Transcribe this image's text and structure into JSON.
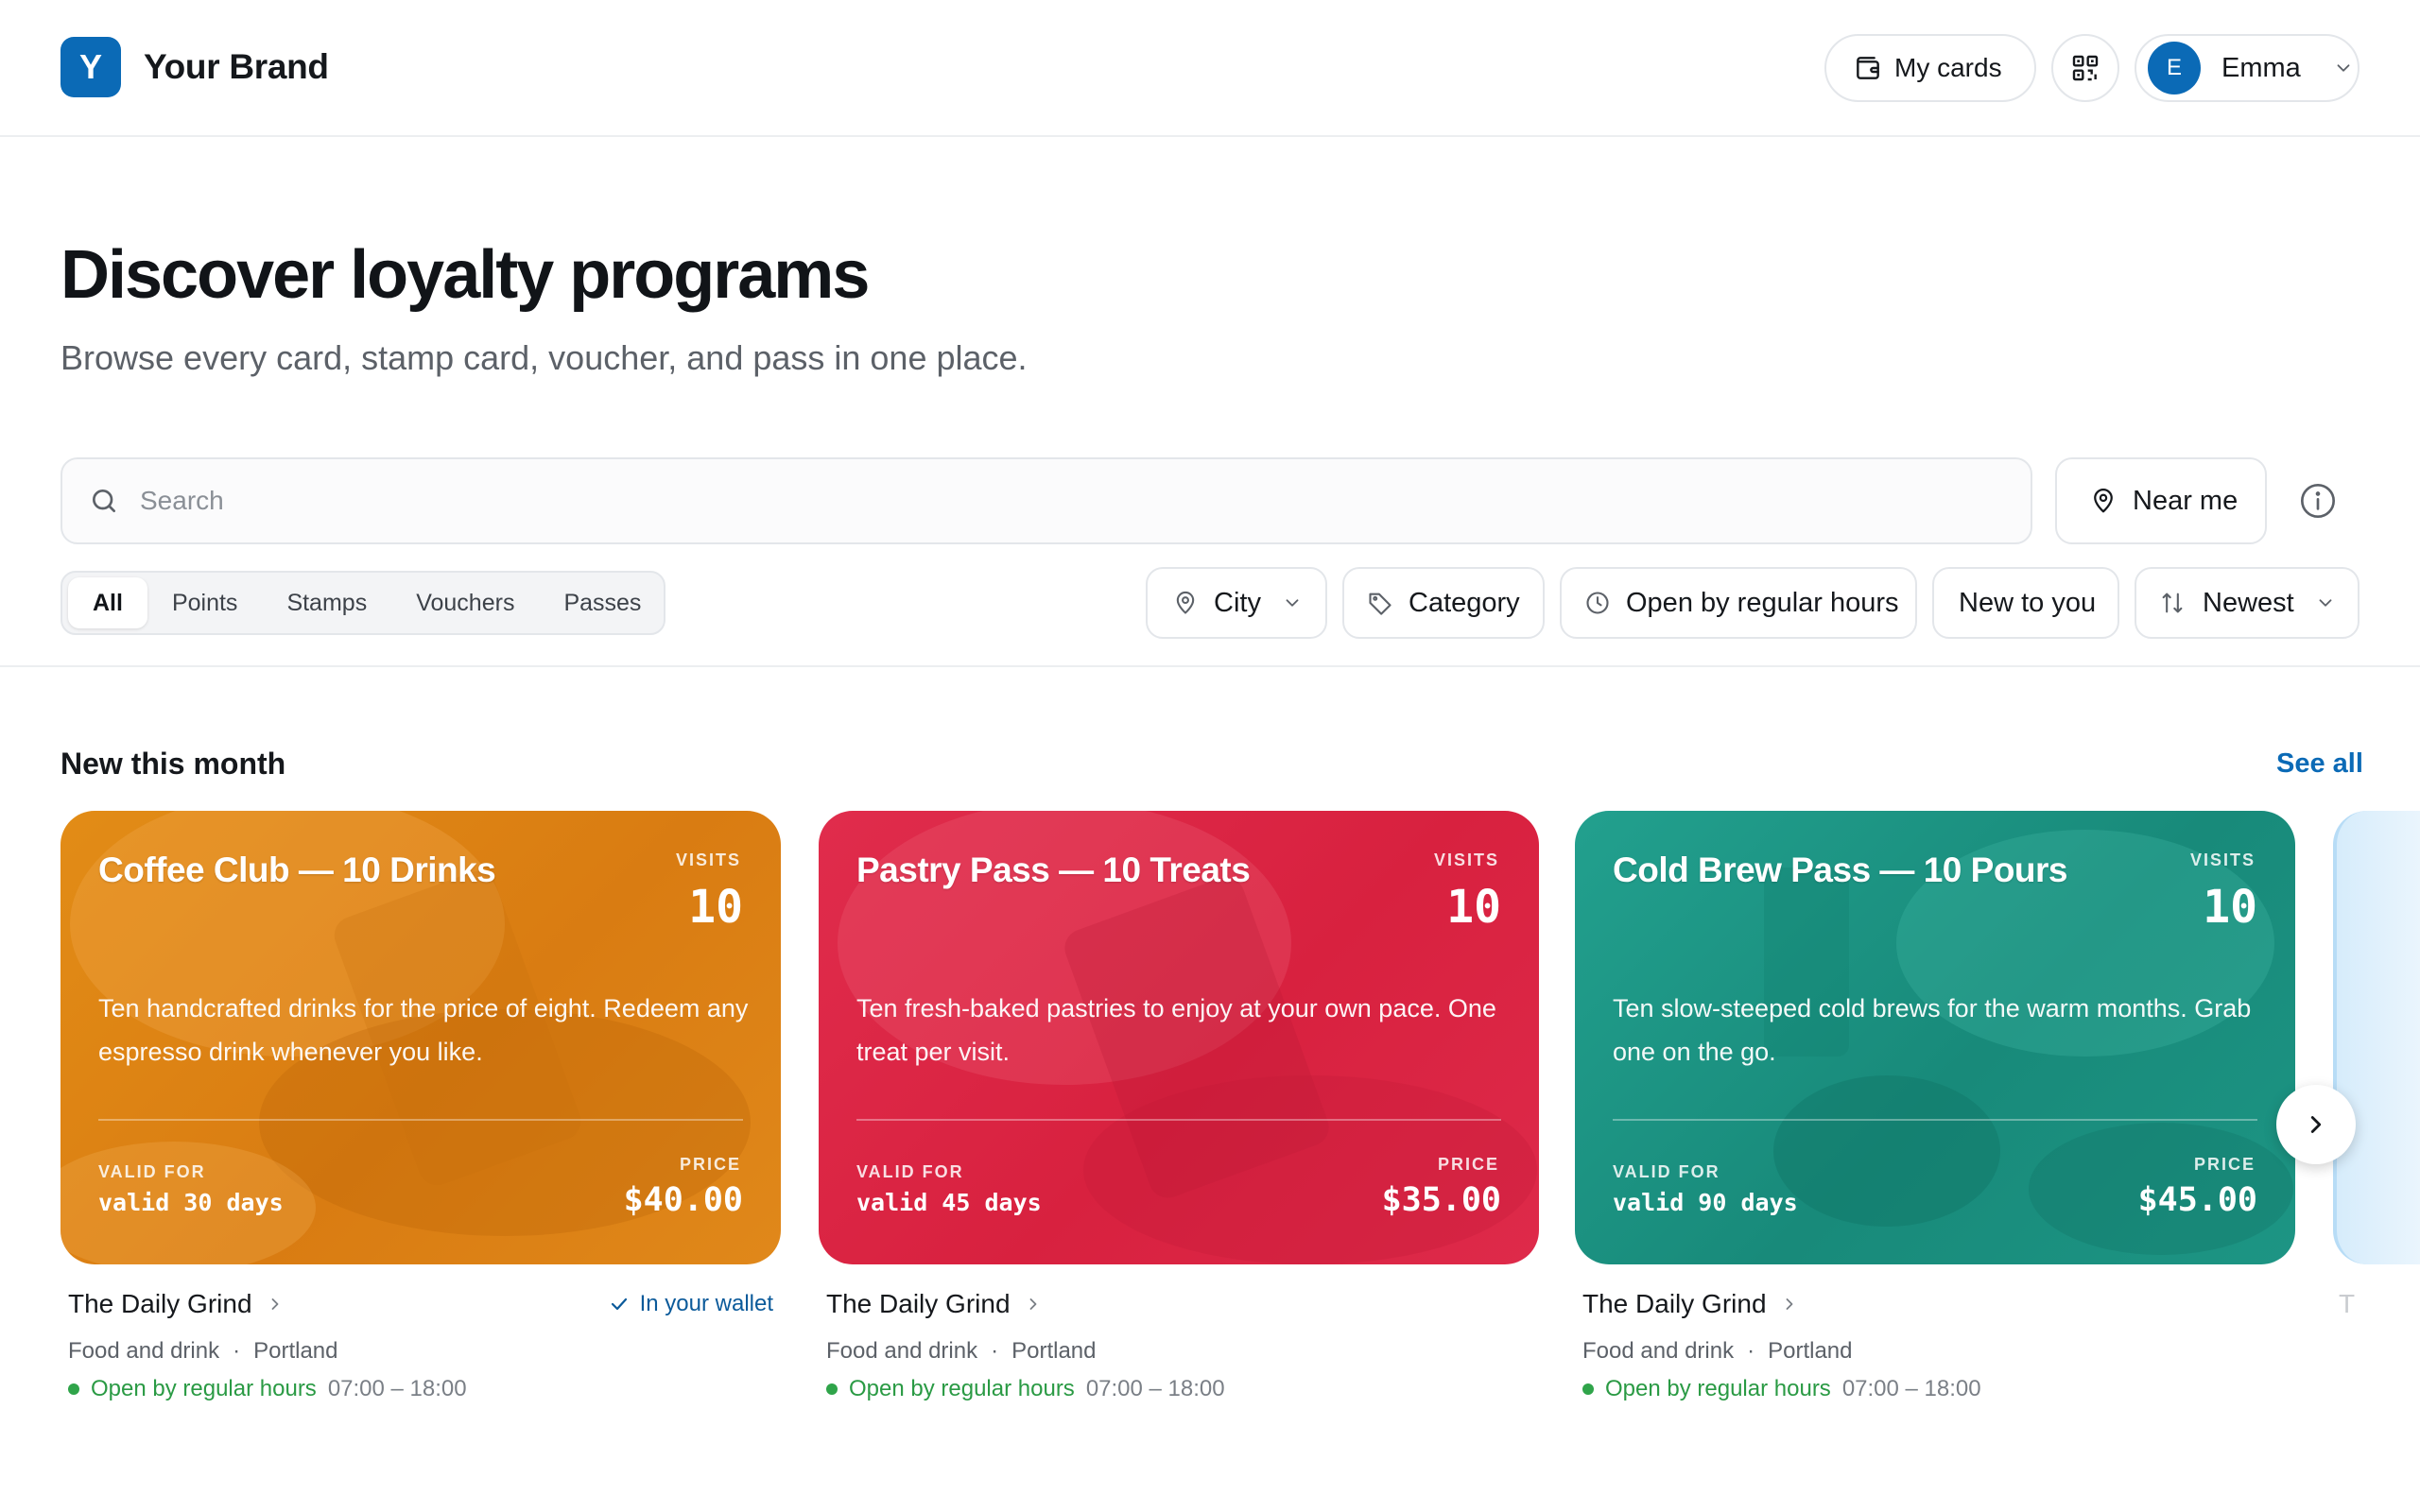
{
  "brand": {
    "logo_letter": "Y",
    "name": "Your Brand",
    "color": "#0b6ab6"
  },
  "header": {
    "my_cards": "My cards",
    "user": {
      "initial": "E",
      "name": "Emma"
    }
  },
  "hero": {
    "title": "Discover loyalty programs",
    "subtitle": "Browse every card, stamp card, voucher, and pass in one place."
  },
  "search": {
    "placeholder": "Search",
    "value": ""
  },
  "near_me": "Near me",
  "tabs": [
    {
      "label": "All",
      "active": true
    },
    {
      "label": "Points",
      "active": false
    },
    {
      "label": "Stamps",
      "active": false
    },
    {
      "label": "Vouchers",
      "active": false
    },
    {
      "label": "Passes",
      "active": false
    }
  ],
  "filters": {
    "city": "City",
    "category": "Category",
    "open": "Open by regular hours",
    "new_to_you": "New to you",
    "sort": "Newest"
  },
  "section": {
    "title": "New this month",
    "see_all": "See all"
  },
  "cards": [
    {
      "title": "Coffee Club — 10 Drinks",
      "kind_label": "VISITS",
      "count": "10",
      "description": "Ten handcrafted drinks for the price of eight. Redeem any espresso drink whenever you like.",
      "valid_label": "VALID FOR",
      "valid": "valid 30 days",
      "price_label": "PRICE",
      "price": "$40.00",
      "color": "#e08a1a",
      "business": "The Daily Grind",
      "in_wallet": "In your wallet",
      "category": "Food and drink",
      "city": "Portland",
      "open_status": "Open by regular hours",
      "hours": "07:00 – 18:00"
    },
    {
      "title": "Pastry Pass — 10 Treats",
      "kind_label": "VISITS",
      "count": "10",
      "description": "Ten fresh-baked pastries to enjoy at your own pace. One treat per visit.",
      "valid_label": "VALID FOR",
      "valid": "valid 45 days",
      "price_label": "PRICE",
      "price": "$35.00",
      "color": "#df2a4a",
      "business": "The Daily Grind",
      "category": "Food and drink",
      "city": "Portland",
      "open_status": "Open by regular hours",
      "hours": "07:00 – 18:00"
    },
    {
      "title": "Cold Brew Pass — 10 Pours",
      "kind_label": "VISITS",
      "count": "10",
      "description": "Ten slow-steeped cold brews for the warm months. Grab one on the go.",
      "valid_label": "VALID FOR",
      "valid": "valid 90 days",
      "price_label": "PRICE",
      "price": "$45.00",
      "color": "#1f9b8a",
      "business": "The Daily Grind",
      "category": "Food and drink",
      "city": "Portland",
      "open_status": "Open by regular hours",
      "hours": "07:00 – 18:00"
    }
  ],
  "peek": {
    "letter": "T"
  },
  "icons": {
    "wallet": "wallet-icon",
    "qr": "qr-code-icon",
    "search": "search-icon",
    "pin": "map-pin-icon",
    "info": "info-icon",
    "tag": "tag-icon",
    "clock": "clock-icon",
    "sort": "sort-icon",
    "chevron": "chevron-down-icon",
    "next": "chevron-right-icon",
    "check": "check-icon"
  }
}
